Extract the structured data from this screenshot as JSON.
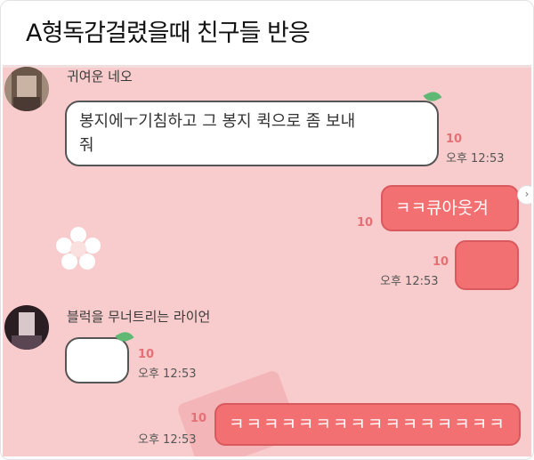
{
  "header": {
    "title": "A형독감걸렸을때 친구들 반응"
  },
  "messages": [
    {
      "sender": "귀여운 네오",
      "text_line1": "봉지에ㅜ기침하고 그 봉지 퀵으로 좀 보내",
      "text_line2": "줘",
      "count": "10",
      "time": "오후 12:53"
    },
    {
      "text": "ㅋㅋ큐아웃겨",
      "count": "10"
    },
    {
      "text": "",
      "count": "10",
      "time": "오후 12:53"
    },
    {
      "sender": "블럭을 무너트리는 라이언",
      "text": "",
      "count": "10",
      "time": "오후 12:53"
    },
    {
      "text": "ㅋㅋㅋㅋㅋㅋㅋㅋㅋㅋㅋㅋㅋㅋㅋㅋㅋ",
      "count": "10",
      "time": "오후 12:53"
    }
  ],
  "colors": {
    "chat_bg": "#f8cccc",
    "out_bubble": "#f26f72",
    "count_text": "#e46f75"
  }
}
